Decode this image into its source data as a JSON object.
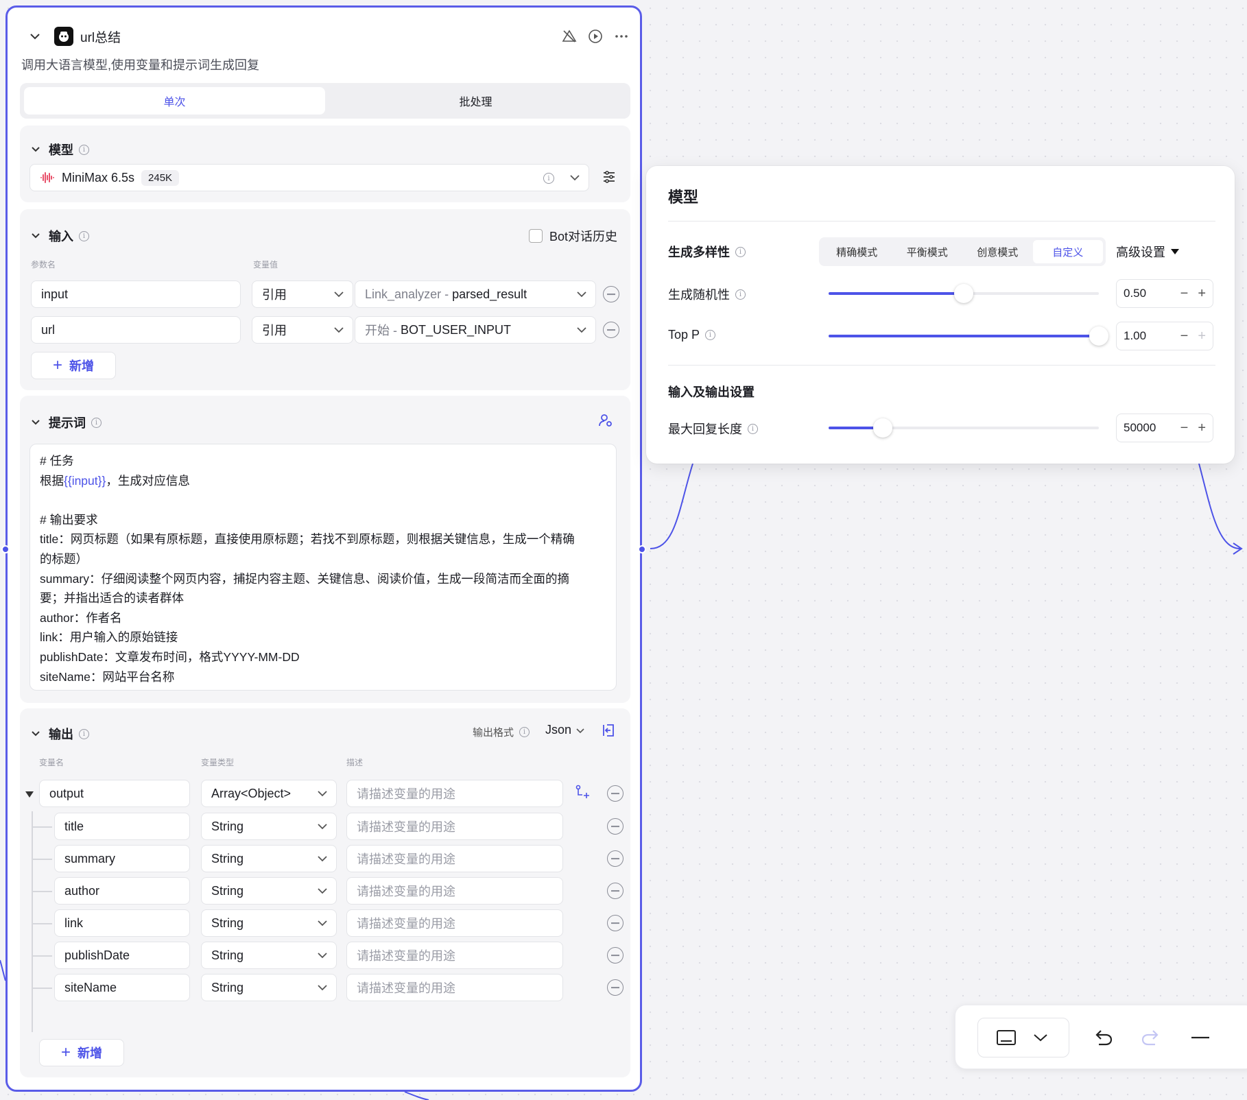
{
  "node": {
    "title": "url总结",
    "description": "调用大语言模型,使用变量和提示词生成回复",
    "tabs": [
      "单次",
      "批处理"
    ],
    "model_section": {
      "title": "模型",
      "model_name": "MiniMax 6.5s",
      "context_badge": "245K"
    },
    "input_section": {
      "title": "输入",
      "bot_history_label": "Bot对话历史",
      "col_param": "参数名",
      "col_value": "变量值",
      "rows": [
        {
          "name": "input",
          "type": "引用",
          "ref_prefix": "Link_analyzer - ",
          "ref_value": "parsed_result"
        },
        {
          "name": "url",
          "type": "引用",
          "ref_prefix": "开始 - ",
          "ref_value": "BOT_USER_INPUT"
        }
      ],
      "add_label": "新增"
    },
    "prompt_section": {
      "title": "提示词",
      "lines": [
        {
          "text": "# 任务"
        },
        {
          "pre": "根据",
          "var": "{{input}}",
          "post": "，生成对应信息"
        },
        {
          "text": ""
        },
        {
          "text": "# 输出要求"
        },
        {
          "text": "title：网页标题（如果有原标题，直接使用原标题；若找不到原标题，则根据关键信息，生成一个精确"
        },
        {
          "text": "的标题）"
        },
        {
          "text": "summary：仔细阅读整个网页内容，捕捉内容主题、关键信息、阅读价值，生成一段简洁而全面的摘"
        },
        {
          "text": "要；并指出适合的读者群体"
        },
        {
          "text": "author：作者名"
        },
        {
          "text": "link：用户输入的原始链接"
        },
        {
          "text": "publishDate：文章发布时间，格式YYYY-MM-DD"
        },
        {
          "text": "siteName：网站平台名称"
        }
      ]
    },
    "output_section": {
      "title": "输出",
      "format_label": "输出格式",
      "format_value": "Json",
      "col_name": "变量名",
      "col_type": "变量类型",
      "col_desc": "描述",
      "desc_placeholder": "请描述变量的用途",
      "root": {
        "name": "output",
        "type": "Array<Object>"
      },
      "children": [
        {
          "name": "title",
          "type": "String"
        },
        {
          "name": "summary",
          "type": "String"
        },
        {
          "name": "author",
          "type": "String"
        },
        {
          "name": "link",
          "type": "String"
        },
        {
          "name": "publishDate",
          "type": "String"
        },
        {
          "name": "siteName",
          "type": "String"
        }
      ],
      "add_label": "新增"
    }
  },
  "model_popup": {
    "title": "模型",
    "diversity_label": "生成多样性",
    "modes": [
      "精确模式",
      "平衡模式",
      "创意模式",
      "自定义"
    ],
    "active_mode": "自定义",
    "advanced_label": "高级设置",
    "temperature": {
      "label": "生成随机性",
      "value": "0.50",
      "fraction": 0.5
    },
    "top_p": {
      "label": "Top P",
      "value": "1.00",
      "fraction": 1.0
    },
    "io_title": "输入及输出设置",
    "max_tokens": {
      "label": "最大回复长度",
      "value": "50000",
      "fraction": 0.2
    }
  },
  "colors": {
    "accent": "#4d53e8",
    "border": "#5a5ce8"
  },
  "icons": [
    "chevron-down-icon",
    "robot-logo-icon",
    "alert-off-icon",
    "play-icon",
    "more-icon",
    "info-icon",
    "settings-sliders-icon",
    "user-settings-icon",
    "export-icon",
    "add-subfield-icon",
    "minus-circle-icon",
    "minimap-icon",
    "undo-icon",
    "redo-icon",
    "zoom-out-icon"
  ]
}
